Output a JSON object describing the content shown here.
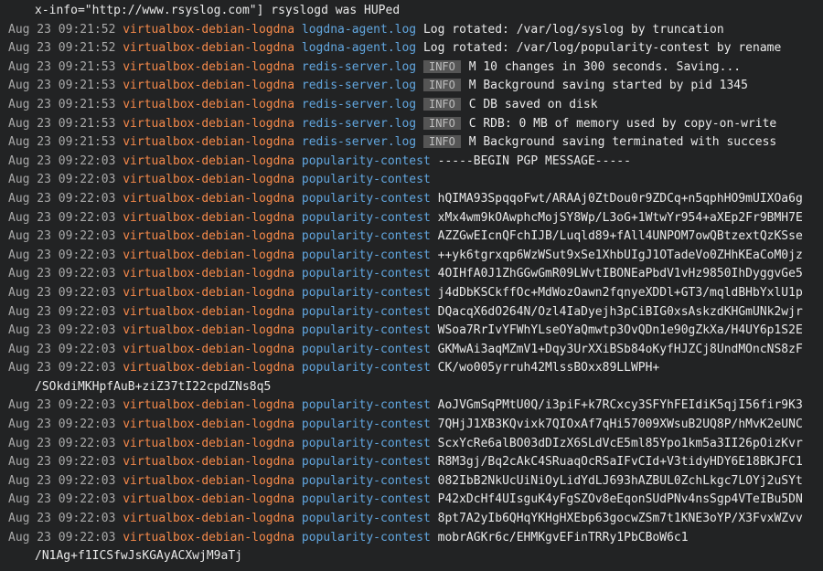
{
  "lines": [
    {
      "type": "cont",
      "text": "x-info=\"http://www.rsyslog.com\"] rsyslogd was HUPed"
    },
    {
      "ts": "Aug 23 09:21:52",
      "host": "virtualbox-debian-logdna",
      "app": "logdna-agent.log",
      "msg": "Log rotated: /var/log/syslog by truncation"
    },
    {
      "ts": "Aug 23 09:21:52",
      "host": "virtualbox-debian-logdna",
      "app": "logdna-agent.log",
      "msg": "Log rotated: /var/log/popularity-contest by rename"
    },
    {
      "ts": "Aug 23 09:21:53",
      "host": "virtualbox-debian-logdna",
      "app": "redis-server.log",
      "badge": "INFO",
      "msg": "M 10 changes in 300 seconds. Saving..."
    },
    {
      "ts": "Aug 23 09:21:53",
      "host": "virtualbox-debian-logdna",
      "app": "redis-server.log",
      "badge": "INFO",
      "msg": "M Background saving started by pid 1345"
    },
    {
      "ts": "Aug 23 09:21:53",
      "host": "virtualbox-debian-logdna",
      "app": "redis-server.log",
      "badge": "INFO",
      "msg": "C DB saved on disk"
    },
    {
      "ts": "Aug 23 09:21:53",
      "host": "virtualbox-debian-logdna",
      "app": "redis-server.log",
      "badge": "INFO",
      "msg": "C RDB: 0 MB of memory used by copy-on-write"
    },
    {
      "ts": "Aug 23 09:21:53",
      "host": "virtualbox-debian-logdna",
      "app": "redis-server.log",
      "badge": "INFO",
      "msg": "M Background saving terminated with success"
    },
    {
      "ts": "Aug 23 09:22:03",
      "host": "virtualbox-debian-logdna",
      "app": "popularity-contest",
      "msg": "-----BEGIN PGP MESSAGE-----"
    },
    {
      "ts": "Aug 23 09:22:03",
      "host": "virtualbox-debian-logdna",
      "app": "popularity-contest",
      "msg": ""
    },
    {
      "ts": "Aug 23 09:22:03",
      "host": "virtualbox-debian-logdna",
      "app": "popularity-contest",
      "msg": "hQIMA93SpqqoFwt/ARAAj0ZtDou0r9ZDCq+n5qphHO9mUIXOa6g"
    },
    {
      "ts": "Aug 23 09:22:03",
      "host": "virtualbox-debian-logdna",
      "app": "popularity-contest",
      "msg": "xMx4wm9kOAwphcMojSY8Wp/L3oG+1WtwYr954+aXEp2Fr9BMH7E"
    },
    {
      "ts": "Aug 23 09:22:03",
      "host": "virtualbox-debian-logdna",
      "app": "popularity-contest",
      "msg": "AZZGwEIcnQFchIJB/Luqld89+fAll4UNPOM7owQBtzextQzKSse"
    },
    {
      "ts": "Aug 23 09:22:03",
      "host": "virtualbox-debian-logdna",
      "app": "popularity-contest",
      "msg": "++yk6tgrxqp6WzWSut9xSe1XhbUIgJ1OTadeVo0ZHhKEaCoM0jz"
    },
    {
      "ts": "Aug 23 09:22:03",
      "host": "virtualbox-debian-logdna",
      "app": "popularity-contest",
      "msg": "4OIHfA0J1ZhGGwGmR09LWvtIBONEaPbdV1vHz9850IhDyggvGe5"
    },
    {
      "ts": "Aug 23 09:22:03",
      "host": "virtualbox-debian-logdna",
      "app": "popularity-contest",
      "msg": "j4dDbKSCkffOc+MdWozOawn2fqnyeXDDl+GT3/mqldBHbYxlU1p"
    },
    {
      "ts": "Aug 23 09:22:03",
      "host": "virtualbox-debian-logdna",
      "app": "popularity-contest",
      "msg": "DQacqX6dO264N/Ozl4IaDyejh3pCiBIG0xsAskzdKHGmUNk2wjr"
    },
    {
      "ts": "Aug 23 09:22:03",
      "host": "virtualbox-debian-logdna",
      "app": "popularity-contest",
      "msg": "WSoa7RrIvYFWhYLseOYaQmwtp3OvQDn1e90gZkXa/H4UY6p1S2E"
    },
    {
      "ts": "Aug 23 09:22:03",
      "host": "virtualbox-debian-logdna",
      "app": "popularity-contest",
      "msg": "GKMwAi3aqMZmV1+Dqy3UrXXiBSb84oKyfHJZCj8UndMOncNS8zF"
    },
    {
      "ts": "Aug 23 09:22:03",
      "host": "virtualbox-debian-logdna",
      "app": "popularity-contest",
      "msg": "CK/wo005yrruh42MlssBOxx89LLWPH+"
    },
    {
      "type": "cont",
      "text": "/SOkdiMKHpfAuB+ziZ37tI22cpdZNs8q5"
    },
    {
      "ts": "Aug 23 09:22:03",
      "host": "virtualbox-debian-logdna",
      "app": "popularity-contest",
      "msg": "AoJVGmSqPMtU0Q/i3piF+k7RCxcy3SFYhFEIdiK5qjI56fir9K3"
    },
    {
      "ts": "Aug 23 09:22:03",
      "host": "virtualbox-debian-logdna",
      "app": "popularity-contest",
      "msg": "7QHjJ1XB3KQvixk7QIOxAf7qHi57009XWsuB2UQ8P/hMvK2eUNC"
    },
    {
      "ts": "Aug 23 09:22:03",
      "host": "virtualbox-debian-logdna",
      "app": "popularity-contest",
      "msg": "ScxYcRe6alBO03dDIzX6SLdVcE5ml85Ypo1km5a3II26pOizKvr"
    },
    {
      "ts": "Aug 23 09:22:03",
      "host": "virtualbox-debian-logdna",
      "app": "popularity-contest",
      "msg": "R8M3gj/Bq2cAkC4SRuaqOcRSaIFvCId+V3tidyHDY6E18BKJFC1"
    },
    {
      "ts": "Aug 23 09:22:03",
      "host": "virtualbox-debian-logdna",
      "app": "popularity-contest",
      "msg": "082IbB2NkUcUiNiOyLidYdLJ693hAZBUL0ZchLkgc7LOYj2uSYt"
    },
    {
      "ts": "Aug 23 09:22:03",
      "host": "virtualbox-debian-logdna",
      "app": "popularity-contest",
      "msg": "P42xDcHf4UIsguK4yFgSZOv8eEqonSUdPNv4nsSgp4VTeIBu5DN"
    },
    {
      "ts": "Aug 23 09:22:03",
      "host": "virtualbox-debian-logdna",
      "app": "popularity-contest",
      "msg": "8pt7A2yIb6QHqYKHgHXEbp63gocwZSm7t1KNE3oYP/X3FvxWZvv"
    },
    {
      "ts": "Aug 23 09:22:03",
      "host": "virtualbox-debian-logdna",
      "app": "popularity-contest",
      "msg": "mobrAGKr6c/EHMKgvEFinTRRy1PbCBoW6c1"
    },
    {
      "type": "cont",
      "text": "/N1Ag+f1ICSfwJsKGAyACXwjM9aTj"
    }
  ]
}
